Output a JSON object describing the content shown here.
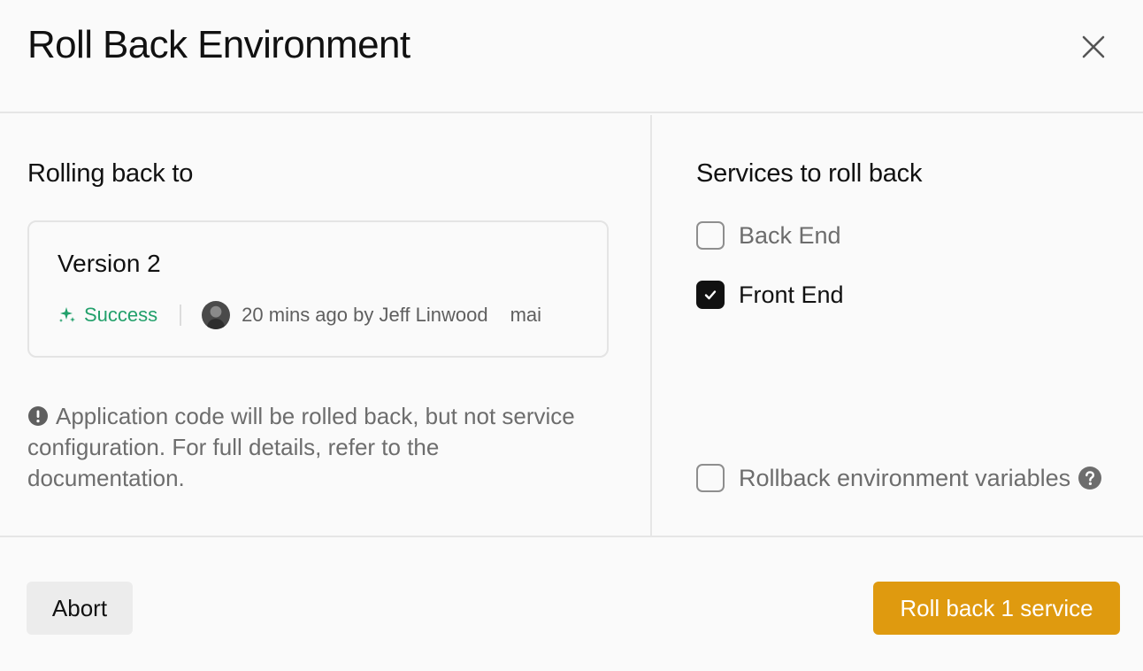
{
  "dialog": {
    "title": "Roll Back Environment"
  },
  "left": {
    "heading": "Rolling back to",
    "version": {
      "name": "Version 2",
      "status": "Success",
      "status_color": "#22a06b",
      "meta": "20 mins ago by Jeff Linwood",
      "branch": "mai"
    },
    "notice": "Application code will be rolled back, but not service configuration. For full details, refer to the documentation."
  },
  "right": {
    "heading": "Services to roll back",
    "services": [
      {
        "label": "Back End",
        "checked": false
      },
      {
        "label": "Front End",
        "checked": true
      }
    ],
    "env_vars": {
      "label": "Rollback environment variables",
      "checked": false
    }
  },
  "footer": {
    "abort_label": "Abort",
    "submit_label": "Roll back 1 service",
    "submit_color": "#df9a0f"
  }
}
